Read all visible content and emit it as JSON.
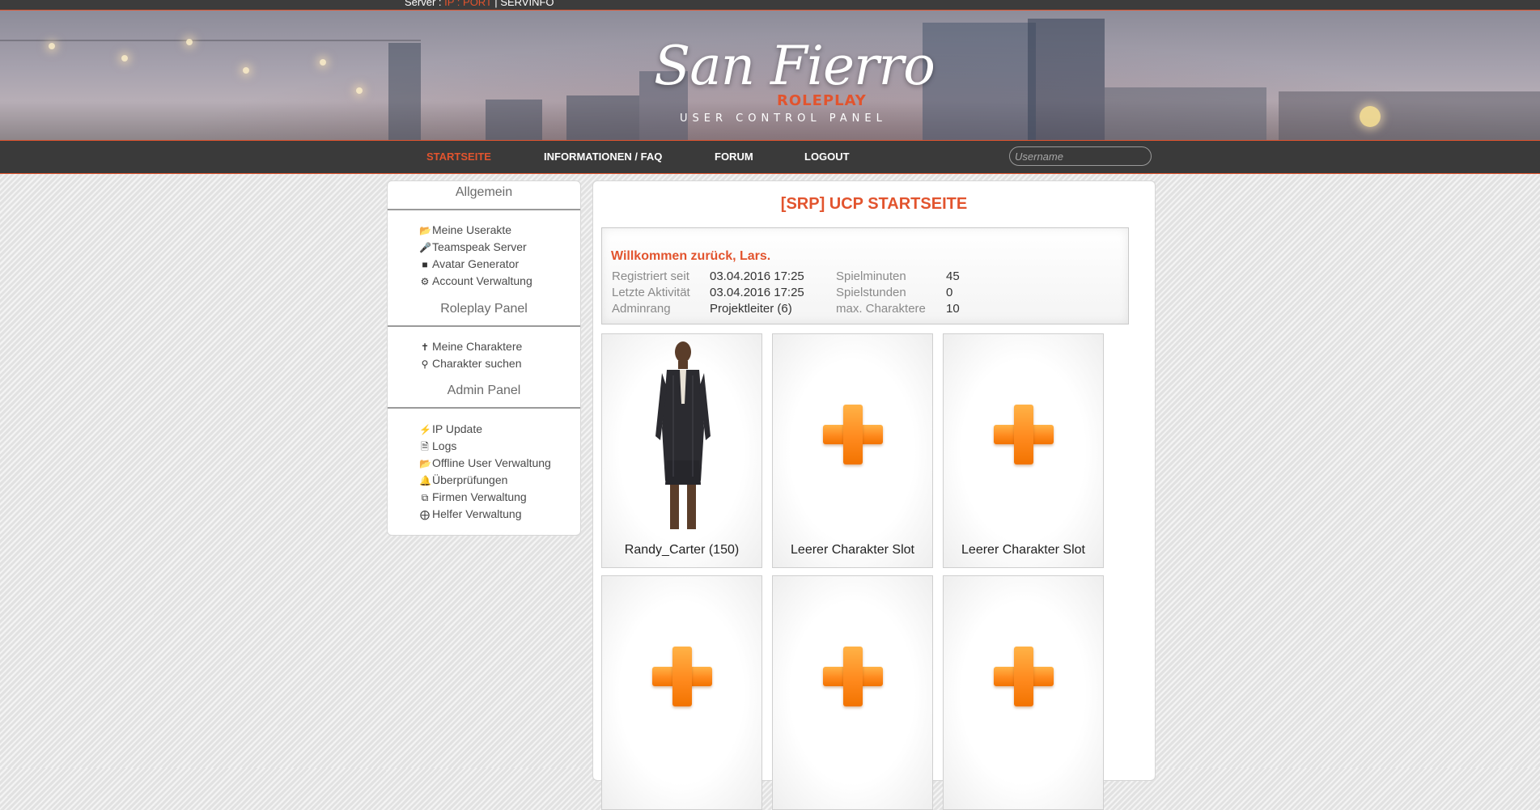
{
  "topbar": {
    "server_label": "Server :",
    "ip_label": "IP : PORT",
    "separator": "|",
    "info_label": "SERVINFO"
  },
  "banner": {
    "logo_script": "San Fierro",
    "logo_roleplay": "ROLEPLAY",
    "logo_subtitle": "USER CONTROL PANEL"
  },
  "nav": {
    "items": [
      {
        "label": "STARTSEITE",
        "active": true
      },
      {
        "label": "INFORMATIONEN / FAQ",
        "active": false
      },
      {
        "label": "FORUM",
        "active": false
      },
      {
        "label": "LOGOUT",
        "active": false
      }
    ],
    "username_placeholder": "Username"
  },
  "sidebar": {
    "sections": [
      {
        "title": "Allgemein",
        "items": [
          {
            "icon": "folder-open-icon",
            "label": "Meine Userakte"
          },
          {
            "icon": "microphone-icon",
            "label": "Teamspeak Server"
          },
          {
            "icon": "book-icon",
            "label": "Avatar Generator"
          },
          {
            "icon": "gear-icon",
            "label": "Account Verwaltung"
          }
        ]
      },
      {
        "title": "Roleplay Panel",
        "items": [
          {
            "icon": "person-icon",
            "label": "Meine Charaktere"
          },
          {
            "icon": "search-icon",
            "label": "Charakter suchen"
          }
        ]
      },
      {
        "title": "Admin Panel",
        "items": [
          {
            "icon": "bolt-icon",
            "label": "IP Update"
          },
          {
            "icon": "file-icon",
            "label": "Logs"
          },
          {
            "icon": "folder-open-icon",
            "label": "Offline User Verwaltung"
          },
          {
            "icon": "bell-icon",
            "label": "Überprüfungen"
          },
          {
            "icon": "copy-icon",
            "label": "Firmen Verwaltung"
          },
          {
            "icon": "lifebuoy-icon",
            "label": "Helfer Verwaltung"
          }
        ]
      }
    ]
  },
  "main": {
    "title": "[SRP] UCP STARTSEITE",
    "welcome": {
      "heading": "Willkommen zurück, Lars.",
      "rows": [
        {
          "label": "Registriert seit",
          "value": "03.04.2016 17:25",
          "label2": "Spielminuten",
          "value2": "45"
        },
        {
          "label": "Letzte Aktivität",
          "value": "03.04.2016 17:25",
          "label2": "Spielstunden",
          "value2": "0"
        },
        {
          "label": "Adminrang",
          "value": "Projektleiter (6)",
          "label2": "max. Charaktere",
          "value2": "10"
        }
      ]
    },
    "characters": [
      {
        "name": "Randy_Carter (150)",
        "empty": false
      },
      {
        "name": "Leerer Charakter Slot",
        "empty": true
      },
      {
        "name": "Leerer Charakter Slot",
        "empty": true
      },
      {
        "name": "",
        "empty": true
      },
      {
        "name": "",
        "empty": true
      },
      {
        "name": "",
        "empty": true
      }
    ]
  },
  "colors": {
    "accent": "#e2542e",
    "navbar": "#3a3a3a",
    "plus": "#ff8a1e"
  }
}
